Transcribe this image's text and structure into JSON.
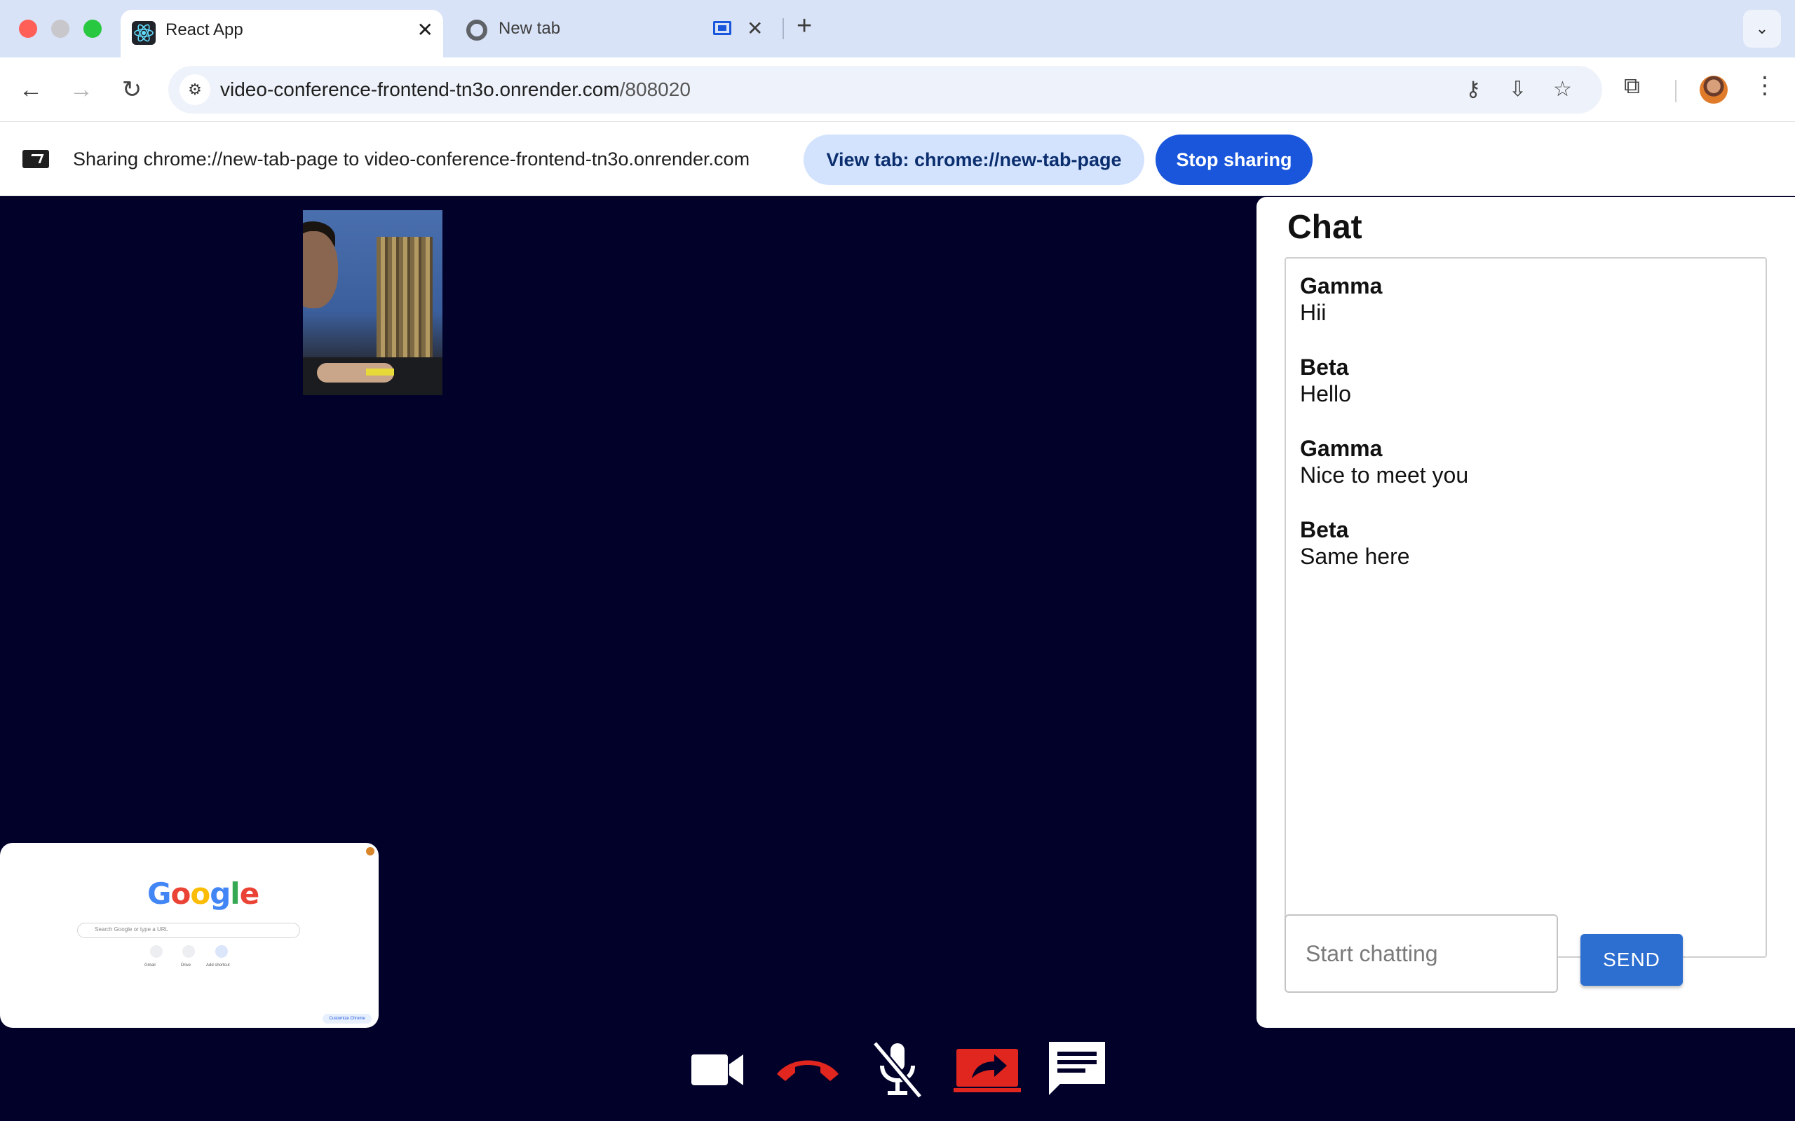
{
  "browser": {
    "tabs": [
      {
        "title": "React App",
        "active": true
      },
      {
        "title": "New tab",
        "active": false
      }
    ],
    "new_tab_glyph": "+",
    "close_glyph": "✕",
    "url_host": "video-conference-frontend-tn3o.onrender.com",
    "url_path": "/808020",
    "toolbar_icons": [
      "back-icon",
      "forward-icon",
      "reload-icon",
      "site-info-icon",
      "key-icon",
      "install-icon",
      "star-icon",
      "extensions-icon",
      "profile-avatar",
      "menu-icon"
    ]
  },
  "share_bar": {
    "text": "Sharing chrome://new-tab-page to video-conference-frontend-tn3o.onrender.com",
    "view_tab_label": "View tab: chrome://new-tab-page",
    "stop_label": "Stop sharing"
  },
  "local_preview": {
    "logo": [
      "G",
      "o",
      "o",
      "g",
      "l",
      "e"
    ],
    "search_placeholder": "Search Google or type a URL",
    "shortcuts": [
      "Gmail",
      "Drive",
      "Add shortcut"
    ],
    "customize_label": "Customize Chrome"
  },
  "chat": {
    "title": "Chat",
    "messages": [
      {
        "sender": "Gamma",
        "text": "Hii"
      },
      {
        "sender": "Beta",
        "text": "Hello"
      },
      {
        "sender": "Gamma",
        "text": "Nice to meet you"
      },
      {
        "sender": "Beta",
        "text": "Same here"
      }
    ],
    "input_placeholder": "Start chatting",
    "send_label": "SEND"
  },
  "controls": [
    "video-camera-icon",
    "end-call-icon",
    "mic-off-icon",
    "screen-share-icon",
    "chat-icon"
  ],
  "colors": {
    "stage_bg": "#01012a",
    "end_call": "#e0261e",
    "share_active": "#e0261e",
    "send_button": "#2c6fd0",
    "stop_sharing": "#1a56db"
  }
}
